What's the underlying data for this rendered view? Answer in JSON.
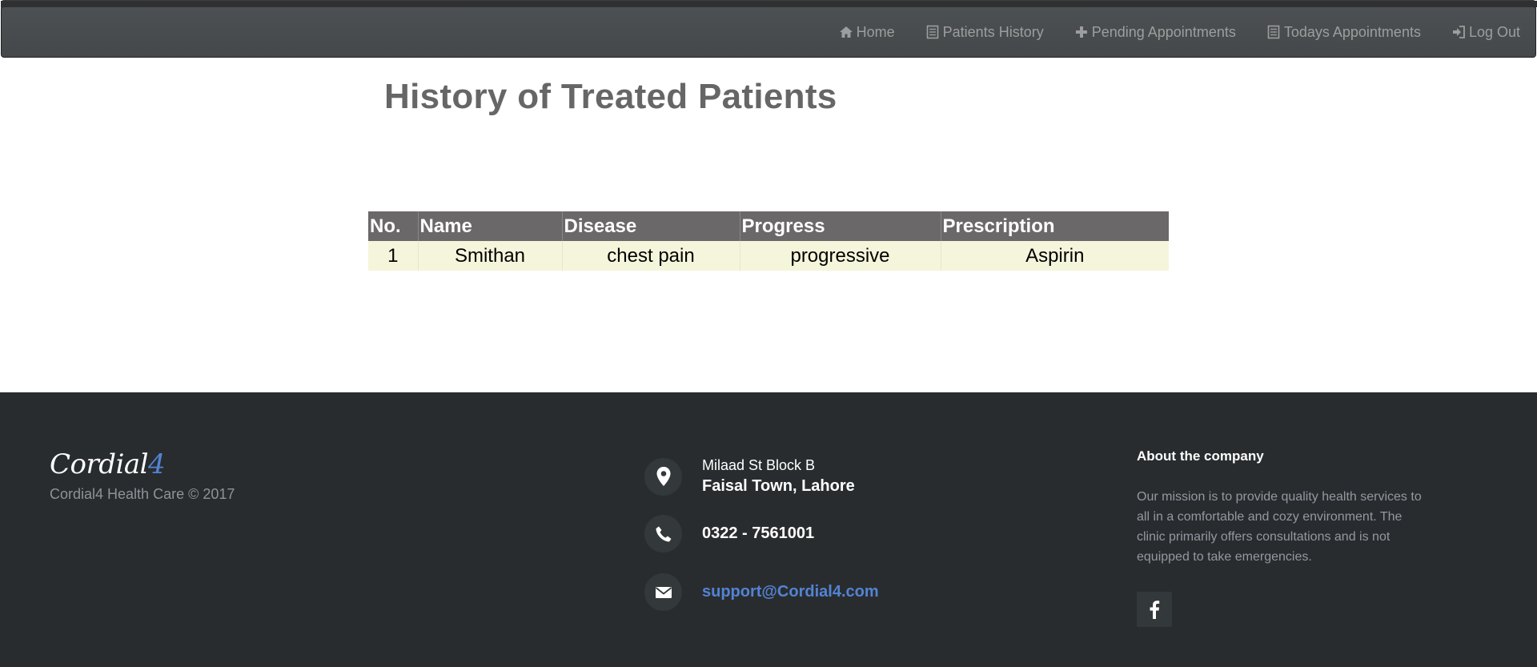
{
  "nav": {
    "items": [
      {
        "label": "Home",
        "icon": "home-icon"
      },
      {
        "label": "Patients History",
        "icon": "list-icon"
      },
      {
        "label": "Pending Appointments",
        "icon": "plus-icon"
      },
      {
        "label": "Todays Appointments",
        "icon": "list-icon"
      },
      {
        "label": "Log Out",
        "icon": "log-out-icon"
      }
    ]
  },
  "main": {
    "title": "History of Treated Patients",
    "table": {
      "columns": [
        "No.",
        "Name",
        "Disease",
        "Progress",
        "Prescription"
      ],
      "rows": [
        [
          "1",
          "Smithan",
          "chest pain",
          "progressive",
          "Aspirin"
        ]
      ]
    }
  },
  "footer": {
    "logo_text": "Cordial",
    "logo_accent": "4",
    "copyright": "Cordial4 Health Care © 2017",
    "address_line1": "Milaad St Block B",
    "address_line2": "Faisal Town, Lahore",
    "phone": "0322 - 7561001",
    "email": "support@Cordial4.com",
    "about_title": "About the company",
    "about_text": "Our mission is to provide quality health services to all in a comfortable and cozy environment. The clinic primarily offers consultations and is not equipped to take emergencies.",
    "social": [
      "facebook-icon"
    ]
  },
  "colors": {
    "navbar": "#4d5052",
    "nav_text": "#9d9d9d",
    "table_header": "#6b686a",
    "table_row": "#f5f5dc",
    "footer_bg": "#292c2f",
    "accent": "#5383d3"
  }
}
